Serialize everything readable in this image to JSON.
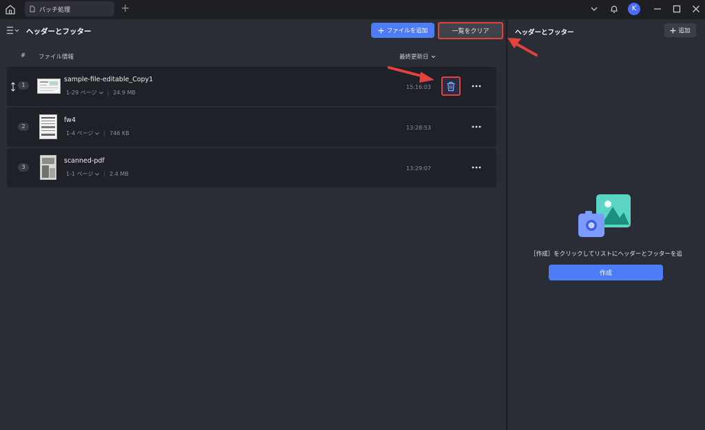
{
  "titlebar": {
    "tab_label": "バッチ処理",
    "avatar_initial": "K"
  },
  "header": {
    "title": "ヘッダーとフッター",
    "add_file_label": "ファイルを追加",
    "clear_list_label": "一覧をクリア"
  },
  "columns": {
    "index": "#",
    "file_info": "ファイル情報",
    "last_modified": "最終更新日"
  },
  "files": [
    {
      "index": "1",
      "name": "sample-file-editable_Copy1",
      "pages": "1-29 ページ",
      "size": "24.9 MB",
      "time": "15:16:03"
    },
    {
      "index": "2",
      "name": "fw4",
      "pages": "1-4 ページ",
      "size": "746 KB",
      "time": "13:28:53"
    },
    {
      "index": "3",
      "name": "scanned-pdf",
      "pages": "1-1 ページ",
      "size": "2.4 MB",
      "time": "13:29:07"
    }
  ],
  "right_panel": {
    "title": "ヘッダーとフッター",
    "add_label": "追加",
    "empty_message": "［作成］をクリックしてリストにヘッダーとフッターを追",
    "create_label": "作成"
  },
  "colors": {
    "accent": "#4d7cf6",
    "highlight": "#e2433c",
    "background": "#2b2d36",
    "row": "#1f2128"
  }
}
